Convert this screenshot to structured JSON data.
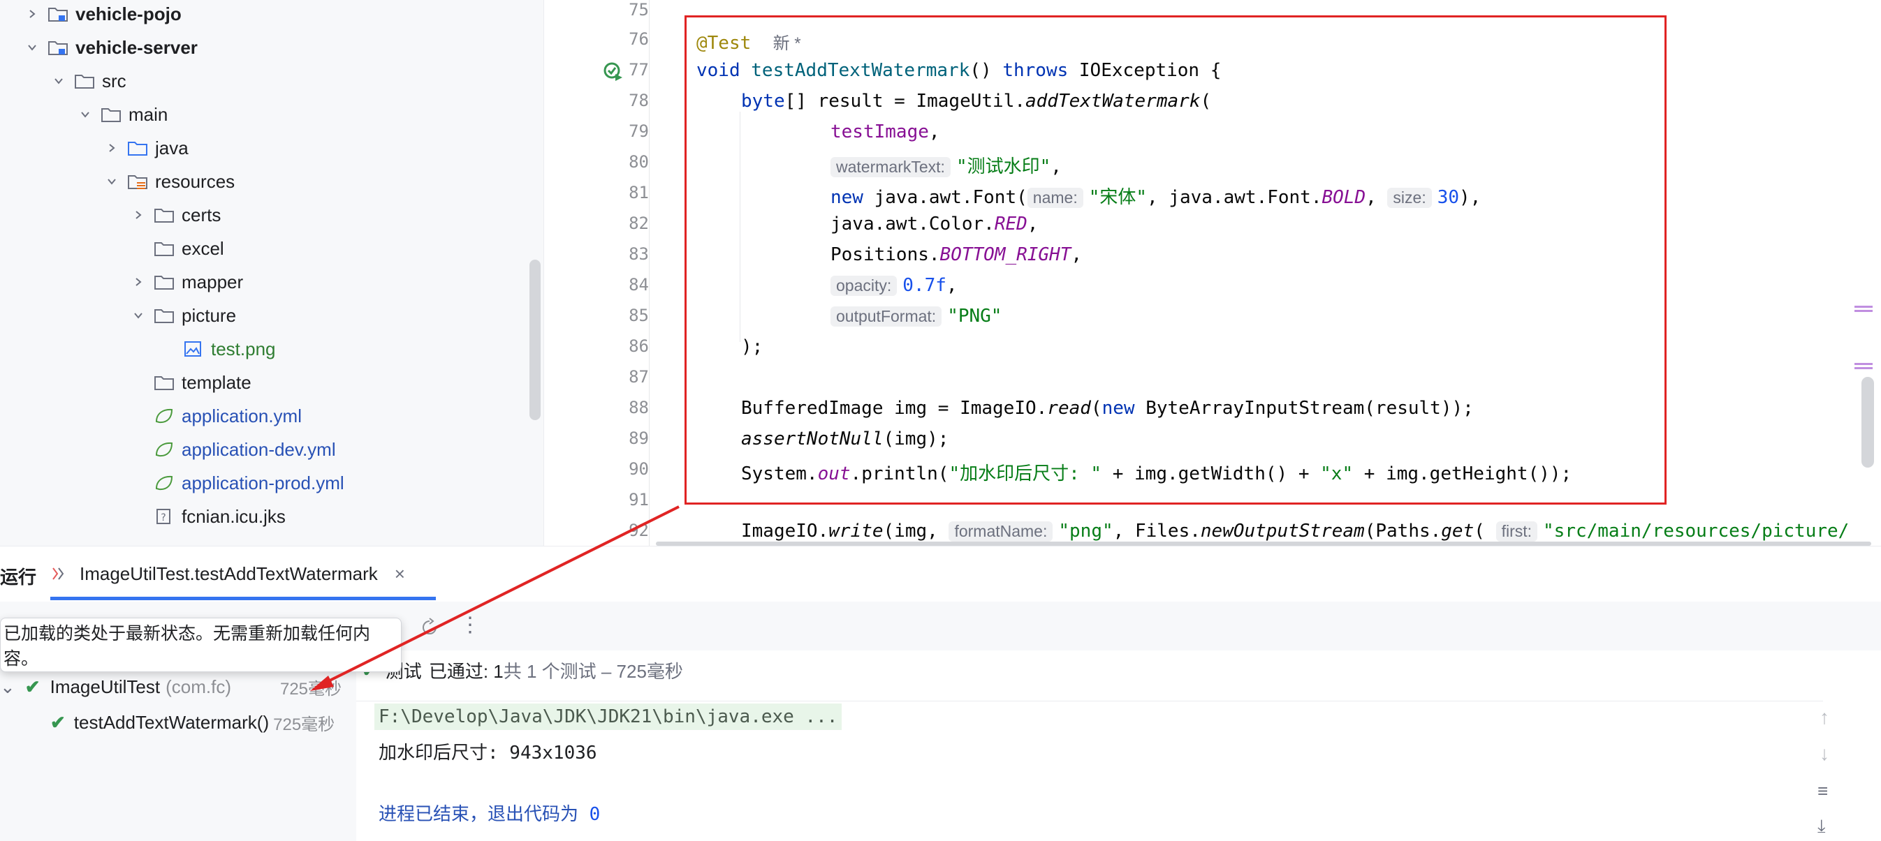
{
  "project_tree": {
    "items": [
      {
        "label": "vehicle-pojo",
        "icon": "module-folder-icon",
        "expanded": false
      },
      {
        "label": "vehicle-server",
        "icon": "module-folder-icon",
        "expanded": true
      },
      {
        "label": "src",
        "icon": "folder-icon",
        "expanded": true
      },
      {
        "label": "main",
        "icon": "folder-icon",
        "expanded": true
      },
      {
        "label": "java",
        "icon": "source-folder-icon",
        "expanded": false
      },
      {
        "label": "resources",
        "icon": "resources-folder-icon",
        "expanded": true
      },
      {
        "label": "certs",
        "icon": "folder-icon",
        "expanded": false
      },
      {
        "label": "excel",
        "icon": "folder-icon"
      },
      {
        "label": "mapper",
        "icon": "folder-icon",
        "expanded": false
      },
      {
        "label": "picture",
        "icon": "folder-icon",
        "expanded": true
      },
      {
        "label": "test.png",
        "icon": "image-file-icon"
      },
      {
        "label": "template",
        "icon": "folder-icon"
      },
      {
        "label": "application.yml",
        "icon": "spring-config-icon"
      },
      {
        "label": "application-dev.yml",
        "icon": "spring-config-icon"
      },
      {
        "label": "application-prod.yml",
        "icon": "spring-config-icon"
      },
      {
        "label": "fcnian.icu.jks",
        "icon": "unknown-file-icon"
      }
    ]
  },
  "editor": {
    "line_numbers": [
      "75",
      "76",
      "77",
      "78",
      "79",
      "80",
      "81",
      "82",
      "83",
      "84",
      "85",
      "86",
      "87",
      "88",
      "89",
      "90",
      "91",
      "92"
    ],
    "annotation": "@Test",
    "new_badge": "新 *",
    "l77": {
      "void": "void",
      "name": "testAddTextWatermark",
      "paren": "() ",
      "throws": "throws",
      "rest": " IOException {"
    },
    "l78": {
      "type": "byte",
      "rest": "[] result = ImageUtil.",
      "method": "addTextWatermark",
      "paren": "("
    },
    "l79": {
      "field": "testImage",
      "comma": ","
    },
    "l80": {
      "hint": "watermarkText:",
      "str": "\"测试水印\"",
      "comma": ","
    },
    "l81": {
      "new": "new",
      "a": " java.awt.Font(",
      "hint1": "name:",
      "str": "\"宋体\"",
      "b": ", java.awt.Font.",
      "const": "BOLD",
      "c": ", ",
      "hint2": "size:",
      "num": "30",
      "d": "),"
    },
    "l82": {
      "a": "java.awt.Color.",
      "const": "RED",
      "b": ","
    },
    "l83": {
      "a": "Positions.",
      "const": "BOTTOM_RIGHT",
      "b": ","
    },
    "l84": {
      "hint": "opacity:",
      "num": "0.7f",
      "b": ","
    },
    "l85": {
      "hint": "outputFormat:",
      "str": "\"PNG\""
    },
    "l86": ");",
    "l88": {
      "a": "BufferedImage img = ImageIO.",
      "m": "read",
      "b": "(",
      "new": "new",
      "c": " ByteArrayInputStream(result));"
    },
    "l89": {
      "m": "assertNotNull",
      "b": "(img);"
    },
    "l90": {
      "a": "System.",
      "out": "out",
      "b": ".println(",
      "s1": "\"加水印后尺寸: \"",
      "c": " + img.getWidth() + ",
      "s2": "\"x\"",
      "d": " + img.getHeight());"
    },
    "l92": {
      "a": "ImageIO.",
      "m": "write",
      "b": "(img, ",
      "hint1": "formatName:",
      "s1": "\"png\"",
      "c": ", Files.",
      "m2": "newOutputStream",
      "d": "(Paths.",
      "m3": "get",
      "e": "( ",
      "hint2": "first:",
      "s2": "\"src/main/resources/picture/"
    }
  },
  "run_panel": {
    "title": "运行",
    "tab_label": "ImageUtilTest.testAddTextWatermark",
    "tooltip": "已加载的类处于最新状态。无需重新加载任何内容。",
    "status_prefix": "测试",
    "status_passed": "已通过: 1",
    "status_detail": "共 1 个测试 – 725毫秒",
    "test_tree": [
      {
        "label": "ImageUtilTest",
        "sub": "(com.fc)",
        "time": "725毫秒"
      },
      {
        "label": "testAddTextWatermark()",
        "time": "725毫秒"
      }
    ],
    "console": {
      "cmd": "F:\\Develop\\Java\\JDK\\JDK21\\bin\\java.exe ...",
      "output": "加水印后尺寸: 943x1036",
      "exit_text": "进程已结束，退出代码为 ",
      "exit_code": "0"
    }
  }
}
